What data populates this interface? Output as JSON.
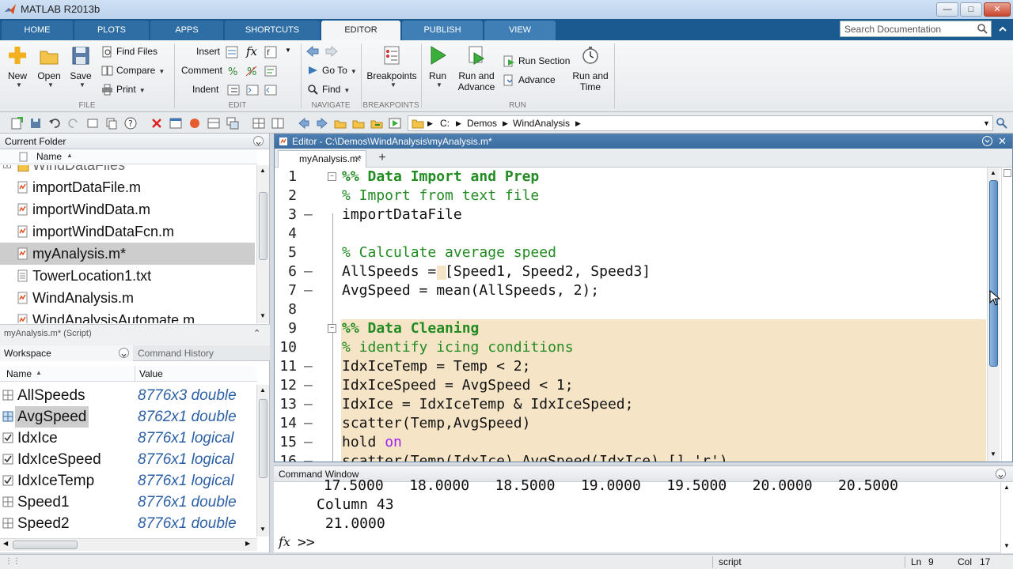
{
  "window": {
    "title": "MATLAB R2013b"
  },
  "ribbon_tabs": [
    "HOME",
    "PLOTS",
    "APPS",
    "SHORTCUTS",
    "EDITOR",
    "PUBLISH",
    "VIEW"
  ],
  "search": {
    "placeholder": "Search Documentation"
  },
  "ribbon": {
    "file": {
      "new": "New",
      "open": "Open",
      "save": "Save",
      "find_files": "Find Files",
      "compare": "Compare",
      "print": "Print",
      "section": "FILE"
    },
    "edit": {
      "insert": "Insert",
      "comment": "Comment",
      "indent": "Indent",
      "section": "EDIT",
      "fx": "fx"
    },
    "navigate": {
      "goto": "Go To",
      "find": "Find",
      "section": "NAVIGATE"
    },
    "breakpoints": {
      "label": "Breakpoints",
      "section": "BREAKPOINTS"
    },
    "run": {
      "run": "Run",
      "run_advance_1": "Run and",
      "run_advance_2": "Advance",
      "run_section": "Run Section",
      "advance": "Advance",
      "run_time_1": "Run and",
      "run_time_2": "Time",
      "section": "RUN"
    }
  },
  "path": {
    "drive": "C:",
    "folder1": "Demos",
    "folder2": "WindAnalysis"
  },
  "current_folder": {
    "title": "Current Folder",
    "column": "Name",
    "items": [
      "WindDataFiles",
      "importDataFile.m",
      "importWindData.m",
      "importWindDataFcn.m",
      "myAnalysis.m*",
      "TowerLocation1.txt",
      "WindAnalysis.m",
      "WindAnalysisAutomate.m"
    ]
  },
  "details": "myAnalysis.m* (Script)",
  "workspace": {
    "tab1": "Workspace",
    "tab2": "Command History",
    "col_name": "Name",
    "col_value": "Value",
    "rows": [
      {
        "name": "AllSpeeds",
        "value": "8776x3 double"
      },
      {
        "name": "AvgSpeed",
        "value": "8762x1 double"
      },
      {
        "name": "IdxIce",
        "value": "8776x1 logical"
      },
      {
        "name": "IdxIceSpeed",
        "value": "8776x1 logical"
      },
      {
        "name": "IdxIceTemp",
        "value": "8776x1 logical"
      },
      {
        "name": "Speed1",
        "value": "8776x1 double"
      },
      {
        "name": "Speed2",
        "value": "8776x1 double"
      }
    ]
  },
  "editor": {
    "title": "Editor - C:\\Demos\\WindAnalysis\\myAnalysis.m*",
    "tab": "myAnalysis.m*",
    "lines": [
      {
        "n": "1",
        "t": "%% Data Import and Prep"
      },
      {
        "n": "2",
        "t": "% Import from text file"
      },
      {
        "n": "3",
        "t": "importDataFile"
      },
      {
        "n": "4",
        "t": ""
      },
      {
        "n": "5",
        "t": "% Calculate average speed"
      },
      {
        "n": "6",
        "t": "AllSpeeds = [Speed1, Speed2, Speed3]"
      },
      {
        "n": "7",
        "t": "AvgSpeed = mean(AllSpeeds, 2);"
      },
      {
        "n": "8",
        "t": ""
      },
      {
        "n": "9",
        "t": "%% Data Cleaning"
      },
      {
        "n": "10",
        "t": "% identify icing conditions"
      },
      {
        "n": "11",
        "t": "IdxIceTemp = Temp < 2;"
      },
      {
        "n": "12",
        "t": "IdxIceSpeed = AvgSpeed < 1;"
      },
      {
        "n": "13",
        "t": "IdxIce = IdxIceTemp & IdxIceSpeed;"
      },
      {
        "n": "14",
        "t": "scatter(Temp,AvgSpeed)"
      },
      {
        "n": "15",
        "t": "hold "
      },
      {
        "n": "16",
        "t": "scatter(Temp(IdxIce),AvgSpeed(IdxIce),[],'r')"
      }
    ],
    "keyword_on": "on"
  },
  "command_window": {
    "title": "Command Window",
    "line1": " 17.5000   18.0000   18.5000   19.0000   19.5000   20.0000   20.5000",
    "line2": "Column 43",
    "line3": " 21.0000",
    "prompt": ">>",
    "fx": "fx"
  },
  "status": {
    "mode": "script",
    "ln_label": "Ln",
    "ln": "9",
    "col_label": "Col",
    "col": "17"
  }
}
